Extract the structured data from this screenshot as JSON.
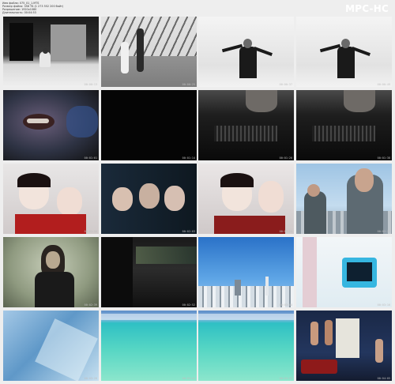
{
  "app": {
    "logo": "MPC-HC"
  },
  "header": {
    "lines": [
      "Имя файла: 075_01_1.MTS",
      "Размер файла: 358 ТБ (1 273 552 200 байт)",
      "Разрешение: 1920x1080",
      "Длительность: 00:04:53"
    ]
  },
  "thumbnails": [
    {
      "name": "thumb-woman-crouching",
      "timestamp": "00:00:13"
    },
    {
      "name": "thumb-figures-under-glass-roof",
      "timestamp": "00:00:25"
    },
    {
      "name": "thumb-man-arms-outstretched-1",
      "timestamp": "00:00:37"
    },
    {
      "name": "thumb-man-arms-outstretched-2",
      "timestamp": "00:00:49"
    },
    {
      "name": "thumb-face-closeup-blue",
      "timestamp": "00:01:01"
    },
    {
      "name": "thumb-dark-frame",
      "timestamp": "00:01:14"
    },
    {
      "name": "thumb-dark-stage-1",
      "timestamp": "00:01:26"
    },
    {
      "name": "thumb-dark-stage-2",
      "timestamp": "00:01:38"
    },
    {
      "name": "thumb-geisha-dolls-1",
      "timestamp": "00:01:50"
    },
    {
      "name": "thumb-three-faces",
      "timestamp": "00:02:03"
    },
    {
      "name": "thumb-geisha-dolls-2",
      "timestamp": "00:02:15"
    },
    {
      "name": "thumb-two-men-city",
      "timestamp": "00:02:27"
    },
    {
      "name": "thumb-woman-green-tint",
      "timestamp": "00:02:39"
    },
    {
      "name": "thumb-dark-street",
      "timestamp": "00:02:52"
    },
    {
      "name": "thumb-city-skyline",
      "timestamp": "00:03:04"
    },
    {
      "name": "thumb-blue-monitor-room",
      "timestamp": "00:03:16"
    },
    {
      "name": "thumb-blue-abstract",
      "timestamp": "00:03:28"
    },
    {
      "name": "thumb-turquoise-sea-1",
      "timestamp": "00:03:41"
    },
    {
      "name": "thumb-turquoise-sea-2",
      "timestamp": "00:03:53"
    },
    {
      "name": "thumb-room-red-sofa",
      "timestamp": "00:04:05"
    }
  ]
}
